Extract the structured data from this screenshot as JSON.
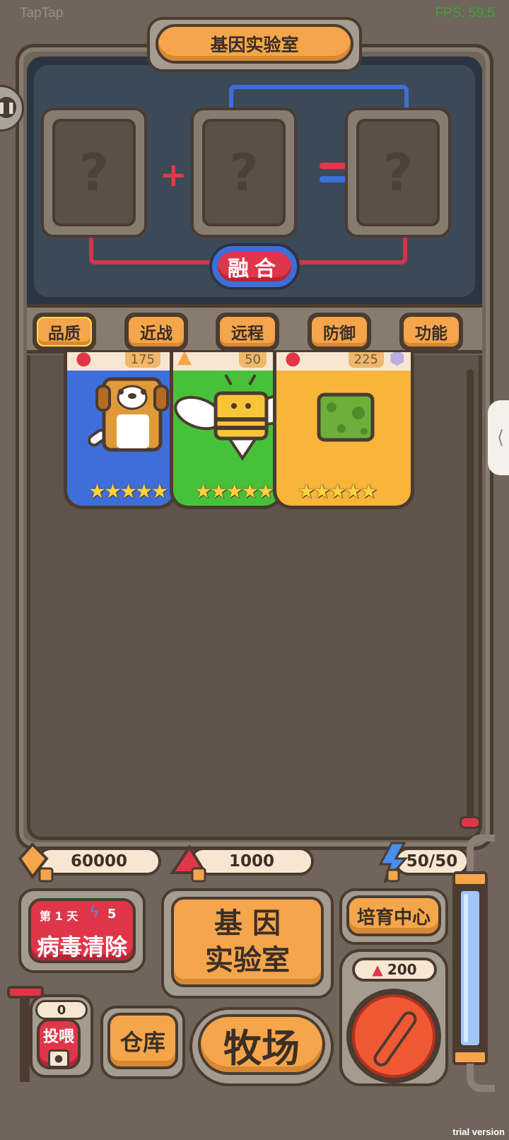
{
  "app": {
    "watermark": "TapTap",
    "fps": "FPS: 59.5",
    "trial": "trial version"
  },
  "lab": {
    "title": "基因实验室",
    "slots": [
      "?",
      "?",
      "?"
    ],
    "plus": "+",
    "fuse_label": "融合"
  },
  "filters": [
    {
      "label": "品质",
      "active": true
    },
    {
      "label": "近战",
      "active": false
    },
    {
      "label": "远程",
      "active": false
    },
    {
      "label": "防御",
      "active": false
    },
    {
      "label": "功能",
      "active": false
    }
  ],
  "cards": [
    {
      "name": "dog",
      "value": "175",
      "color": "#3e6fd8",
      "stars": "★★★★★"
    },
    {
      "name": "bee",
      "value": "50",
      "color": "#46c23a",
      "stars": "★★★★★"
    },
    {
      "name": "frog-block",
      "value": "225",
      "color": "#f9b53a",
      "stars": "★★★★★"
    }
  ],
  "resources": {
    "crystal": "60000",
    "gem": "1000",
    "energy": "50/50"
  },
  "buttons": {
    "virus": {
      "day": "第 1 天",
      "cost": "5",
      "label": "病毒清除"
    },
    "gene_lab": {
      "line1": "基 因",
      "line2": "实验室"
    },
    "breed": "培育中心",
    "warehouse": "仓库",
    "ranch": "牧场",
    "feed": {
      "count": "0",
      "label": "投喂"
    },
    "big_red_cost": "200"
  }
}
